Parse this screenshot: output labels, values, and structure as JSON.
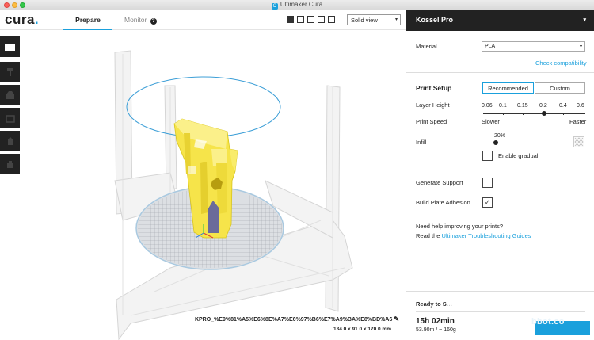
{
  "window": {
    "title": "Ultimaker Cura"
  },
  "header": {
    "logo": "cura",
    "tabs": [
      {
        "label": "Prepare"
      },
      {
        "label": "Monitor"
      }
    ],
    "monitor_help": "?",
    "view_mode": "Solid view"
  },
  "left_tools": [
    "open-file",
    "translate",
    "scale",
    "rotate",
    "mirror",
    "per-model-settings"
  ],
  "viewport": {
    "model_name": "KPRO_%E9%81%A5%E6%8E%A7%E6%97%B6%E7%A9%BA%E8%BD%A6",
    "model_dims": "134.0 x 91.0 x 170.0 mm"
  },
  "panel": {
    "printer": "Kossel Pro",
    "material_label": "Material",
    "material_value": "PLA",
    "check_compat": "Check compatibility",
    "print_setup": "Print Setup",
    "recommended": "Recommended",
    "custom": "Custom",
    "layer_height_label": "Layer Height",
    "layer_heights": [
      "0.06",
      "0.1",
      "0.15",
      "0.2",
      "0.4",
      "0.6"
    ],
    "layer_height_selected": "0.2",
    "print_speed_label": "Print Speed",
    "slower": "Slower",
    "faster": "Faster",
    "infill_label": "Infill",
    "infill_value": "20%",
    "infill_fraction": 0.2,
    "enable_gradual": "Enable gradual",
    "generate_support": "Generate Support",
    "generate_support_checked": false,
    "build_plate_adhesion": "Build Plate Adhesion",
    "build_plate_adhesion_checked": true,
    "help_question": "Need help improving your prints?",
    "help_read": "Read the ",
    "help_link": "Ultimaker Troubleshooting Guides",
    "ready": "Ready to S",
    "print_time": "15h 02min",
    "usage": "53.90m / ~ 160g",
    "watermark": "bbot.co"
  },
  "colors": {
    "accent": "#1aa0dc",
    "dark": "#222222",
    "model": "#f6e44a"
  }
}
